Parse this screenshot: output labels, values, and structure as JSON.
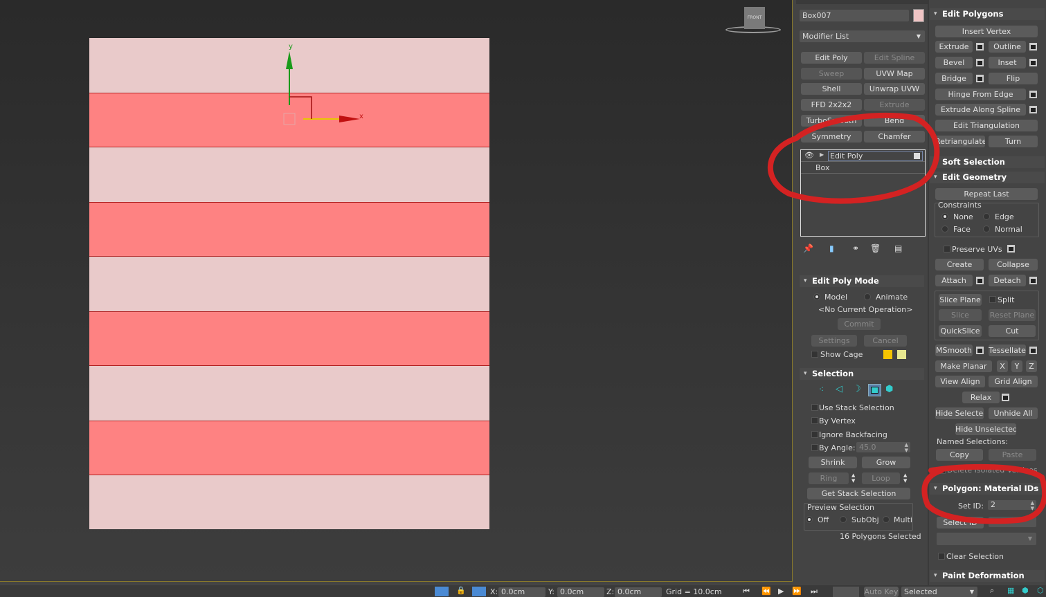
{
  "viewport": {
    "axis_x_label": "x",
    "axis_y_label": "y",
    "viewcube_label": "FRONT",
    "object_colors": {
      "unselected": "#e9caca",
      "selected": "#fe8282"
    },
    "stripes": [
      "light",
      "red",
      "light",
      "red",
      "light",
      "red",
      "light",
      "red",
      "light"
    ]
  },
  "object": {
    "name": "Box007",
    "color": "#f0c4c4"
  },
  "modifier_list": {
    "label": "Modifier List"
  },
  "modifier_buttons": [
    {
      "label": "Edit Poly",
      "enabled": true
    },
    {
      "label": "Edit Spline",
      "enabled": false
    },
    {
      "label": "Sweep",
      "enabled": false
    },
    {
      "label": "UVW Map",
      "enabled": true
    },
    {
      "label": "Shell",
      "enabled": true
    },
    {
      "label": "Unwrap UVW",
      "enabled": true
    },
    {
      "label": "FFD 2x2x2",
      "enabled": true
    },
    {
      "label": "Extrude",
      "enabled": false
    },
    {
      "label": "TurboSmooth",
      "enabled": true
    },
    {
      "label": "Bend",
      "enabled": true
    },
    {
      "label": "Symmetry",
      "enabled": true
    },
    {
      "label": "Chamfer",
      "enabled": true
    }
  ],
  "stack": {
    "items": [
      {
        "label": "Edit Poly",
        "selected": true
      },
      {
        "label": "Box",
        "selected": false
      }
    ]
  },
  "edit_poly_mode": {
    "title": "Edit Poly Mode",
    "model": "Model",
    "animate": "Animate",
    "mode": "Model",
    "operation": "<No Current Operation>",
    "commit": "Commit",
    "settings": "Settings",
    "cancel": "Cancel",
    "show_cage": "Show Cage",
    "cage_colors": [
      "#f5c400",
      "#e8e890"
    ]
  },
  "selection": {
    "title": "Selection",
    "levels": [
      "vertex",
      "edge",
      "border",
      "polygon",
      "element"
    ],
    "active_level": "polygon",
    "use_stack": "Use Stack Selection",
    "by_vertex": "By Vertex",
    "ignore_backfacing": "Ignore Backfacing",
    "by_angle": "By Angle:",
    "angle_value": "45.0",
    "shrink": "Shrink",
    "grow": "Grow",
    "ring": "Ring",
    "loop": "Loop",
    "get_stack": "Get Stack Selection",
    "preview_title": "Preview Selection",
    "preview_off": "Off",
    "preview_subobj": "SubObj",
    "preview_multi": "Multi",
    "preview_value": "Off",
    "status": "16 Polygons Selected"
  },
  "edit_polygons": {
    "title": "Edit Polygons",
    "insert_vertex": "Insert Vertex",
    "extrude": "Extrude",
    "outline": "Outline",
    "bevel": "Bevel",
    "inset": "Inset",
    "bridge": "Bridge",
    "flip": "Flip",
    "hinge": "Hinge From Edge",
    "extrude_spline": "Extrude Along Spline",
    "edit_tri": "Edit Triangulation",
    "retri": "Retriangulate",
    "turn": "Turn"
  },
  "soft_selection": {
    "title": "Soft Selection"
  },
  "edit_geometry": {
    "title": "Edit Geometry",
    "repeat_last": "Repeat Last",
    "constraints": "Constraints",
    "none": "None",
    "edge": "Edge",
    "face": "Face",
    "normal": "Normal",
    "constraint_value": "None",
    "preserve_uvs": "Preserve UVs",
    "create": "Create",
    "collapse": "Collapse",
    "attach": "Attach",
    "detach": "Detach",
    "slice_plane": "Slice Plane",
    "split": "Split",
    "slice": "Slice",
    "reset_plane": "Reset Plane",
    "quickslice": "QuickSlice",
    "cut": "Cut",
    "msmooth": "MSmooth",
    "tessellate": "Tessellate",
    "make_planar": "Make Planar",
    "x": "X",
    "y": "Y",
    "z": "Z",
    "view_align": "View Align",
    "grid_align": "Grid Align",
    "relax": "Relax",
    "hide_selected": "Hide Selected",
    "unhide_all": "Unhide All",
    "hide_unselected": "Hide Unselected",
    "named_selections": "Named Selections:",
    "copy": "Copy",
    "paste": "Paste",
    "delete_isolated": "Delete Isolated Vertices"
  },
  "material_ids": {
    "title": "Polygon: Material IDs",
    "set_id_label": "Set ID:",
    "set_id": "2",
    "select_id": "Select ID",
    "clear_selection": "Clear Selection"
  },
  "paint_deformation": {
    "title": "Paint Deformation"
  },
  "status_bar": {
    "x_label": "X:",
    "x": "0.0cm",
    "y_label": "Y:",
    "y": "0.0cm",
    "z_label": "Z:",
    "z": "0.0cm",
    "grid": "Grid = 10.0cm",
    "auto_key": "Auto Key",
    "key_filter": "Selected"
  },
  "annotation_color": "#d42222"
}
